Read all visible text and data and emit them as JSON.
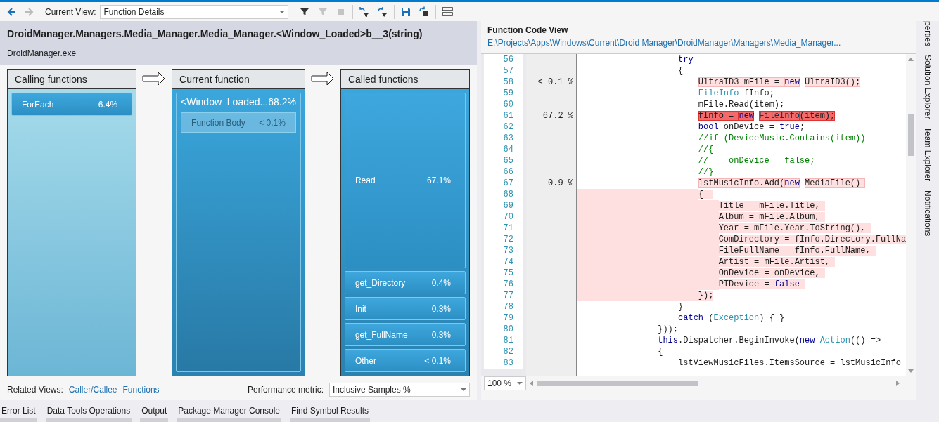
{
  "toolbar": {
    "back_enabled": true,
    "forward_enabled": false,
    "view_label": "Current View:",
    "view_value": "Function Details",
    "tools": [
      {
        "kind": "filter",
        "disabled": false
      },
      {
        "kind": "filter",
        "disabled": true
      },
      {
        "kind": "stop",
        "disabled": true
      },
      {
        "kind": "filter-back",
        "disabled": false
      },
      {
        "kind": "filter-forward",
        "disabled": false
      },
      {
        "kind": "save",
        "disabled": false
      },
      {
        "kind": "compare",
        "disabled": false
      },
      {
        "kind": "layout",
        "disabled": false
      }
    ]
  },
  "function_header": {
    "title": "DroidManager.Managers.Media_Manager.Media_Manager.<Window_Loaded>b__3(string)",
    "module": "DroidManager.exe"
  },
  "columns": [
    {
      "title": "Calling functions",
      "kind": "calling",
      "items": [
        {
          "name": "ForEach",
          "value": "6.4%",
          "kind": "row"
        }
      ]
    },
    {
      "title": "Current function",
      "kind": "current",
      "items": [
        {
          "name": "<Window_Loaded...",
          "value": "68.2%",
          "kind": "group",
          "children": [
            {
              "name": "Function Body",
              "value": "< 0.1%",
              "kind": "body"
            }
          ]
        }
      ]
    },
    {
      "title": "Called functions",
      "kind": "called",
      "items": [
        {
          "name": "Read",
          "value": "67.1%",
          "kind": "fill"
        },
        {
          "name": "get_Directory",
          "value": "0.4%",
          "kind": "row"
        },
        {
          "name": "Init",
          "value": "0.3%",
          "kind": "row"
        },
        {
          "name": "get_FullName",
          "value": "0.3%",
          "kind": "row"
        },
        {
          "name": "Other",
          "value": "< 0.1%",
          "kind": "row"
        }
      ]
    }
  ],
  "related_views": {
    "label": "Related Views:",
    "links": [
      "Caller/Callee",
      "Functions"
    ]
  },
  "metric": {
    "label": "Performance metric:",
    "value": "Inclusive Samples %"
  },
  "code_view": {
    "title": "Function Code View",
    "path": "E:\\Projects\\Apps\\Windows\\Current\\Droid Manager\\DroidManager\\Managers\\Media_Manager...",
    "zoom": "100 %",
    "lines": [
      {
        "number": "56",
        "kind": "plain",
        "segments": [
          {
            "text": "                    try",
            "kind": "keyword"
          }
        ]
      },
      {
        "number": "57",
        "kind": "plain",
        "segments": [
          {
            "text": "                    {"
          }
        ]
      },
      {
        "number": "58",
        "percent": "< 0.1 %",
        "kind": "warm",
        "segments": [
          {
            "text": "                        UltraID3 mFile = "
          },
          {
            "text": "new",
            "kind": "keyword"
          },
          {
            "text": " UltraID3();"
          }
        ]
      },
      {
        "number": "59",
        "kind": "plain",
        "segments": [
          {
            "text": "                        FileInfo",
            "kind": "type"
          },
          {
            "text": " fInfo;"
          }
        ]
      },
      {
        "number": "60",
        "kind": "plain",
        "segments": [
          {
            "text": "                        mFile.Read(item);"
          }
        ]
      },
      {
        "number": "61",
        "percent": "67.2 %",
        "kind": "hot",
        "segments": [
          {
            "text": "                        fInfo = "
          },
          {
            "text": "new",
            "kind": "keyword"
          },
          {
            "text": " FileInfo",
            "kind": "type"
          },
          {
            "text": "(item);"
          }
        ]
      },
      {
        "number": "62",
        "kind": "plain",
        "segments": [
          {
            "text": "                        bool",
            "kind": "keyword"
          },
          {
            "text": " onDevice = "
          },
          {
            "text": "true",
            "kind": "keyword"
          },
          {
            "text": ";"
          }
        ]
      },
      {
        "number": "63",
        "kind": "plain",
        "segments": [
          {
            "text": "                        //if (DeviceMusic.Contains(item))",
            "kind": "comment"
          }
        ]
      },
      {
        "number": "64",
        "kind": "plain",
        "segments": [
          {
            "text": "                        //{",
            "kind": "comment"
          }
        ]
      },
      {
        "number": "65",
        "kind": "plain",
        "segments": [
          {
            "text": "                        //    onDevice = false;",
            "kind": "comment"
          }
        ]
      },
      {
        "number": "66",
        "kind": "plain",
        "segments": [
          {
            "text": "                        //}",
            "kind": "comment"
          }
        ]
      },
      {
        "number": "67",
        "percent": "0.9 %",
        "kind": "warm",
        "segments": [
          {
            "text": "                        lstMusicInfo.Add("
          },
          {
            "text": "new",
            "kind": "keyword"
          },
          {
            "text": " MediaFile() "
          }
        ]
      },
      {
        "number": "68",
        "kind": "block",
        "segments": [
          {
            "text": "                        {  "
          }
        ]
      },
      {
        "number": "69",
        "kind": "block",
        "segments": [
          {
            "text": "                            Title = mFile.Title, "
          }
        ]
      },
      {
        "number": "70",
        "kind": "block",
        "segments": [
          {
            "text": "                            Album = mFile.Album, "
          }
        ]
      },
      {
        "number": "71",
        "kind": "block",
        "segments": [
          {
            "text": "                            Year = mFile.Year.ToString(), "
          }
        ]
      },
      {
        "number": "72",
        "kind": "block",
        "segments": [
          {
            "text": "                            ComDirectory = fInfo.Directory.FullNa"
          }
        ]
      },
      {
        "number": "73",
        "kind": "block",
        "segments": [
          {
            "text": "                            FileFullName = fInfo.FullName, "
          }
        ]
      },
      {
        "number": "74",
        "kind": "block",
        "segments": [
          {
            "text": "                            Artist = mFile.Artist, "
          }
        ]
      },
      {
        "number": "75",
        "kind": "block",
        "segments": [
          {
            "text": "                            OnDevice = onDevice, "
          }
        ]
      },
      {
        "number": "76",
        "kind": "block",
        "segments": [
          {
            "text": "                            PTDevice = "
          },
          {
            "text": "false ",
            "kind": "keyword"
          }
        ]
      },
      {
        "number": "77",
        "kind": "block",
        "segments": [
          {
            "text": "                        });"
          }
        ]
      },
      {
        "number": "78",
        "kind": "plain",
        "segments": [
          {
            "text": "                    }"
          }
        ]
      },
      {
        "number": "79",
        "kind": "plain",
        "segments": [
          {
            "text": "                    catch",
            "kind": "keyword"
          },
          {
            "text": " ("
          },
          {
            "text": "Exception",
            "kind": "type"
          },
          {
            "text": ") { }"
          }
        ]
      },
      {
        "number": "80",
        "kind": "plain",
        "segments": [
          {
            "text": "                }));"
          }
        ]
      },
      {
        "number": "81",
        "kind": "plain",
        "segments": [
          {
            "text": "                this",
            "kind": "keyword"
          },
          {
            "text": ".Dispatcher.BeginInvoke("
          },
          {
            "text": "new",
            "kind": "keyword"
          },
          {
            "text": " Action",
            "kind": "type"
          },
          {
            "text": "(() =>"
          }
        ]
      },
      {
        "number": "82",
        "kind": "plain",
        "segments": [
          {
            "text": "                {"
          }
        ]
      },
      {
        "number": "83",
        "kind": "plain",
        "segments": [
          {
            "text": "                    lstViewMusicFiles.ItemsSource = lstMusicInfo"
          }
        ]
      }
    ]
  },
  "side_tabs": [
    "perties",
    "Solution Explorer",
    "Team Explorer",
    "Notifications"
  ],
  "bottom_tabs": [
    "Error List",
    "Data Tools Operations",
    "Output",
    "Package Manager Console",
    "Find Symbol Results"
  ]
}
